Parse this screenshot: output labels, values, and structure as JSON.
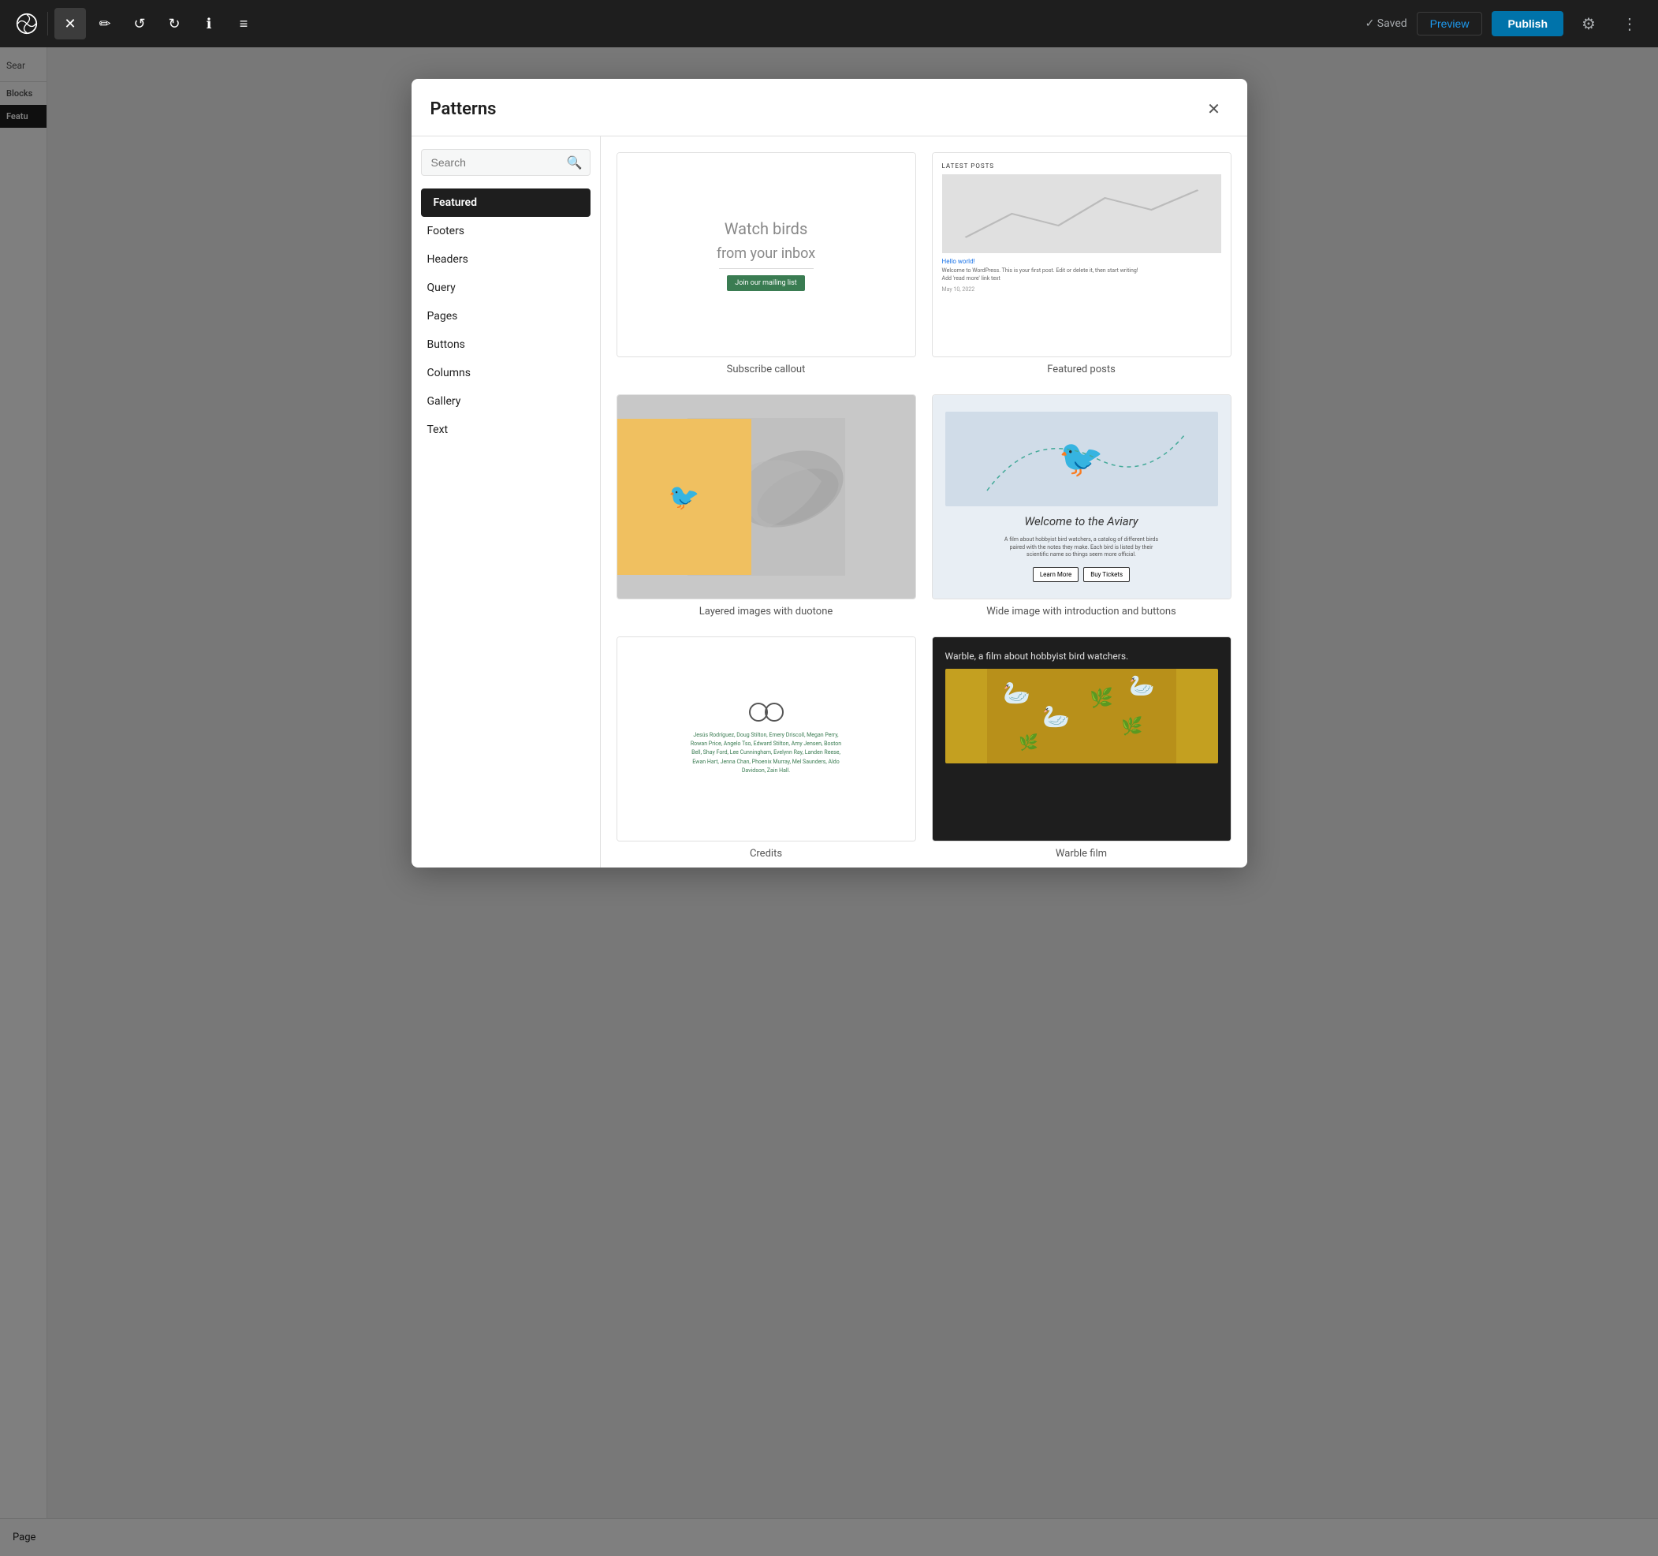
{
  "topbar": {
    "logo_label": "WordPress",
    "close_label": "×",
    "undo_label": "↺",
    "redo_label": "↻",
    "info_label": "ℹ",
    "list_label": "≡",
    "saved_label": "✓ Saved",
    "preview_label": "Preview",
    "publish_label": "Publish",
    "gear_label": "⚙",
    "dots_label": "⋮"
  },
  "modal": {
    "title": "Patterns",
    "close_label": "✕",
    "search": {
      "placeholder": "Search",
      "icon": "🔍"
    },
    "nav_items": [
      {
        "id": "featured",
        "label": "Featured",
        "active": true
      },
      {
        "id": "footers",
        "label": "Footers",
        "active": false
      },
      {
        "id": "headers",
        "label": "Headers",
        "active": false
      },
      {
        "id": "query",
        "label": "Query",
        "active": false
      },
      {
        "id": "pages",
        "label": "Pages",
        "active": false
      },
      {
        "id": "buttons",
        "label": "Buttons",
        "active": false
      },
      {
        "id": "columns",
        "label": "Columns",
        "active": false
      },
      {
        "id": "gallery",
        "label": "Gallery",
        "active": false
      },
      {
        "id": "text",
        "label": "Text",
        "active": false
      }
    ],
    "patterns": [
      {
        "id": "subscribe-callout",
        "label": "Subscribe callout",
        "preview_type": "subscribe"
      },
      {
        "id": "featured-posts",
        "label": "Featured posts",
        "preview_type": "featured-posts"
      },
      {
        "id": "layered-images-duotone",
        "label": "Layered images with duotone",
        "preview_type": "layered"
      },
      {
        "id": "wide-image-introduction",
        "label": "Wide image with introduction and buttons",
        "preview_type": "wide-image"
      },
      {
        "id": "credits",
        "label": "Credits",
        "preview_type": "credits"
      },
      {
        "id": "warble-film",
        "label": "Warble film",
        "preview_type": "warble"
      }
    ]
  },
  "subscribe": {
    "line1": "Watch birds",
    "line2": "from your inbox",
    "button": "Join our mailing list"
  },
  "featured_posts": {
    "heading": "LATEST POSTS",
    "post_title": "Hello world!",
    "post_text": "Welcome to WordPress. This is your first post. Edit or delete it, then start writing!",
    "read_more": "Add 'read more' link text",
    "date": "May 10, 2022"
  },
  "aviary": {
    "title": "Welcome to the Aviary",
    "description": "A film about hobbyist bird watchers, a catalog of different birds paired with the notes they make. Each bird is listed by their scientific name so things seem more official.",
    "btn1": "Learn More",
    "btn2": "Buy Tickets"
  },
  "warble": {
    "title": "Warble",
    "subtitle": ", a film about hobbyist bird watchers."
  },
  "bottom": {
    "page_label": "Page"
  },
  "left_sidebar": {
    "search_label": "Sear",
    "blocks_label": "Blocks",
    "featured_label": "Featu"
  }
}
